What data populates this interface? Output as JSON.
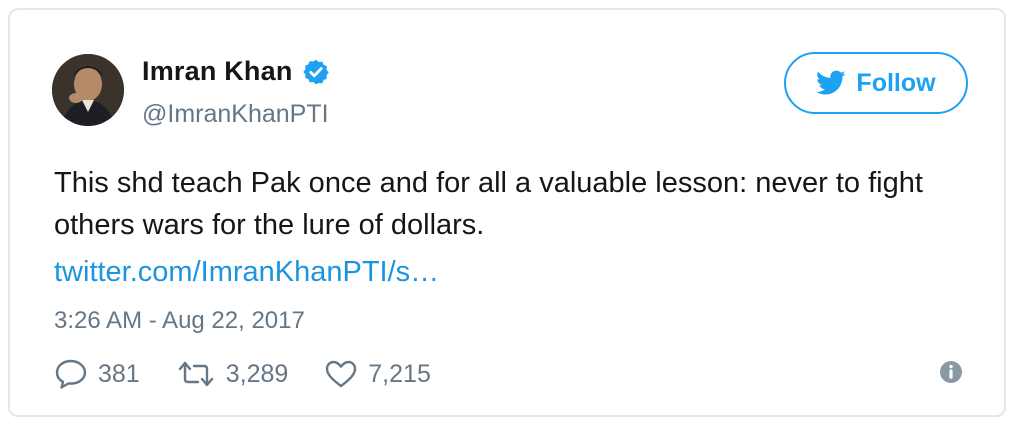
{
  "author": {
    "name": "Imran Khan",
    "handle": "@ImranKhanPTI",
    "verified": true,
    "avatar": "profile-photo"
  },
  "follow_button": {
    "label": "Follow",
    "icon": "twitter-bird-icon"
  },
  "tweet": {
    "text": "This shd teach Pak once and for all a valuable lesson: never to fight others wars for the lure of dollars.",
    "link": "twitter.com/ImranKhanPTI/s…",
    "timestamp": "3:26 AM - Aug 22, 2017"
  },
  "actions": {
    "replies": {
      "count": "381",
      "icon": "reply-icon"
    },
    "retweets": {
      "count": "3,289",
      "icon": "retweet-icon"
    },
    "likes": {
      "count": "7,215",
      "icon": "heart-icon"
    },
    "info": {
      "icon": "info-icon"
    }
  },
  "colors": {
    "accent": "#1da1f2",
    "link": "#1b95e0",
    "secondary_text": "#657786",
    "border": "#e1e8ed",
    "primary_text": "#14171a"
  }
}
